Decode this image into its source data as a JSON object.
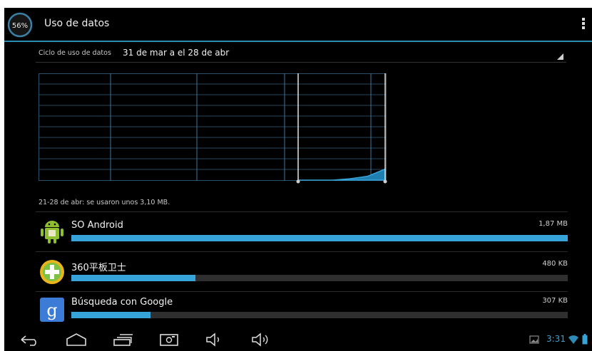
{
  "actionbar": {
    "battery_badge": "56%",
    "title": "Uso de datos"
  },
  "cycle": {
    "label": "Ciclo de uso de datos",
    "value": "31 de mar a el 28 de abr"
  },
  "chart_data": {
    "type": "area",
    "series": [
      {
        "values": [
          0,
          0,
          0,
          0.4,
          1.1,
          3.1
        ]
      }
    ],
    "ylabel": "",
    "xlabel": ""
  },
  "summary": "21-28 de abr: se usaron unos 3,10 MB.",
  "apps": [
    {
      "name": "SO Android",
      "size": "1,87 MB",
      "fraction": 1.0
    },
    {
      "name": "360平板卫士",
      "size": "480 KB",
      "fraction": 0.25
    },
    {
      "name": "Búsqueda con Google",
      "size": "307 KB",
      "fraction": 0.16
    }
  ],
  "status": {
    "time": "3:31"
  },
  "colors": {
    "accent": "#36a3d9",
    "accent_line": "#2a8bb5"
  },
  "icons": {
    "app": "data-usage-icon",
    "overflow": "overflow-menu-icon",
    "back": "back-icon",
    "home": "home-icon",
    "recents": "recent-apps-icon",
    "screenshot": "screenshot-icon",
    "volume_down": "volume-down-icon",
    "volume_up": "volume-up-icon"
  }
}
